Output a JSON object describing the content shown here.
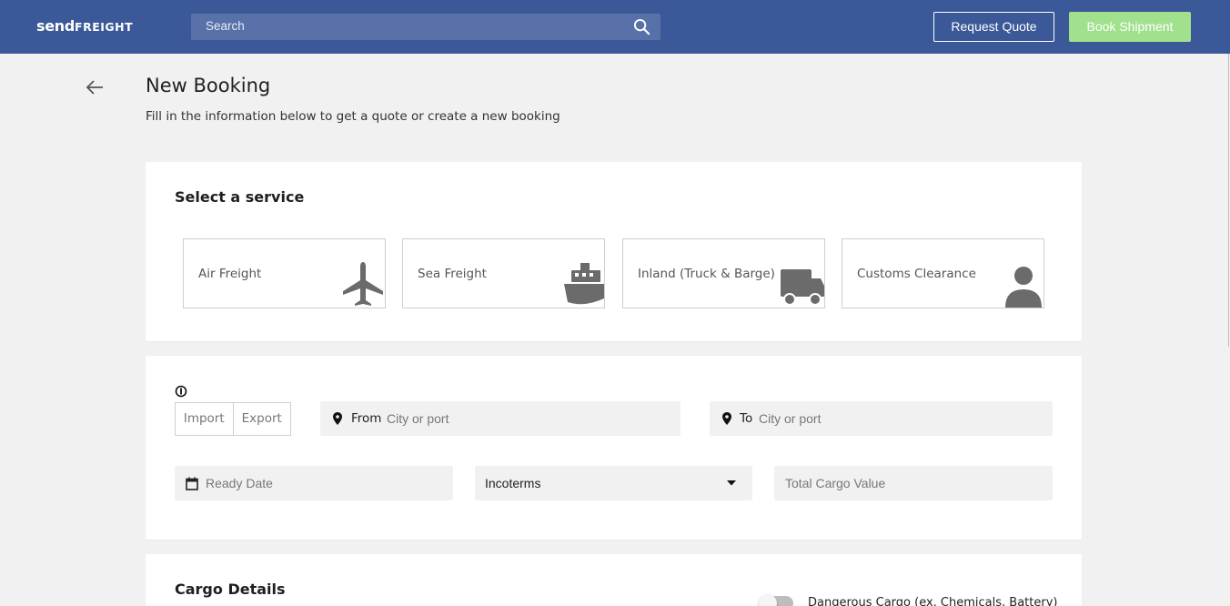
{
  "brand": {
    "logo_part1": "send",
    "logo_part2": "FREIGHT"
  },
  "header": {
    "search_placeholder": "Search",
    "request_quote_label": "Request Quote",
    "book_shipment_label": "Book Shipment"
  },
  "page": {
    "title": "New Booking",
    "subtitle": "Fill in the information below to get a quote or create a new booking"
  },
  "service_section": {
    "title": "Select a service",
    "services": [
      {
        "label": "Air Freight",
        "icon": "airplane-icon"
      },
      {
        "label": "Sea Freight",
        "icon": "ship-icon"
      },
      {
        "label": "Inland (Truck & Barge)",
        "icon": "truck-icon"
      },
      {
        "label": "Customs Clearance",
        "icon": "person-icon"
      }
    ]
  },
  "route_section": {
    "direction_options": [
      "Import",
      "Export"
    ],
    "from_prefix": "From",
    "from_placeholder": "City or port",
    "to_prefix": "To",
    "to_placeholder": "City or port",
    "ready_date_placeholder": "Ready Date",
    "incoterms_value": "Incoterms",
    "total_cargo_value_placeholder": "Total Cargo Value"
  },
  "cargo_section": {
    "title": "Cargo Details",
    "dangerous_cargo_label": "Dangerous Cargo (ex. Chemicals, Battery)",
    "dangerous_cargo_enabled": false
  },
  "colors": {
    "header_bg": "#3b5998",
    "search_bg": "#5872a9",
    "book_button_bg": "#a1e08d",
    "page_bg": "#f1f1f1",
    "icon_gray": "#6b6b6b"
  }
}
